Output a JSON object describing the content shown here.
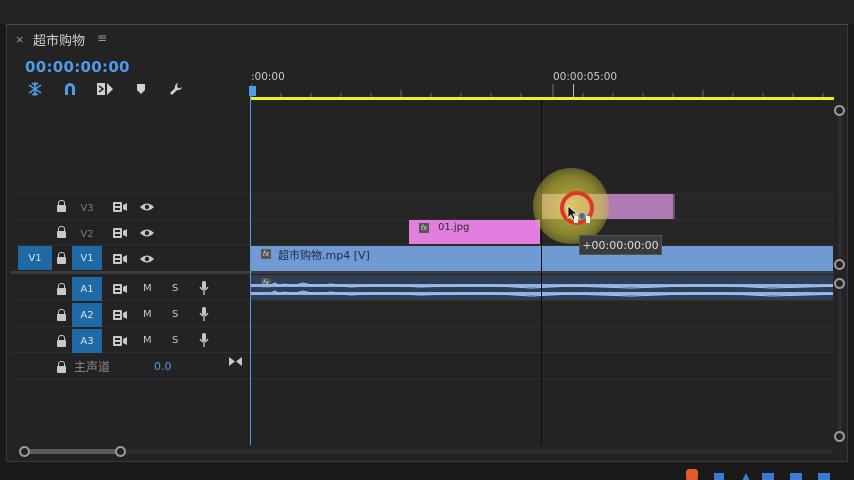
{
  "panel": {
    "close_glyph": "×",
    "title": "超市购物",
    "menu_glyph": "≡"
  },
  "timecode": "00:00:00:00",
  "ruler": {
    "start_label": ":00:00",
    "mid_label": "00:00:05:00"
  },
  "tracks": {
    "video": [
      {
        "label": "V3"
      },
      {
        "label": "V2"
      },
      {
        "label": "V1",
        "target": "V1"
      }
    ],
    "audio": [
      {
        "label": "A1",
        "m": "M",
        "s": "S"
      },
      {
        "label": "A2",
        "m": "M",
        "s": "S"
      },
      {
        "label": "A3",
        "m": "M",
        "s": "S"
      }
    ],
    "master": {
      "label": "主声道",
      "value": "0.0"
    }
  },
  "clips": {
    "v2": {
      "fx": "fx",
      "name": "01.jpg"
    },
    "v1": {
      "fx": "fx",
      "name": "超市购物.mp4 [V]"
    },
    "a1": {
      "fx": "fx"
    }
  },
  "tooltip": "+00:00:00:00",
  "colors": {
    "accent_blue": "#4f9be8",
    "work_area": "#f0ee24",
    "clip_pink": "#e27fde",
    "clip_blue": "#6f9ad4",
    "track_target": "#1f6aa5"
  },
  "icons": {
    "toolbar": [
      "snap-icon",
      "magnet-icon",
      "linked-selection-icon",
      "marker-icon",
      "wrench-icon"
    ]
  }
}
